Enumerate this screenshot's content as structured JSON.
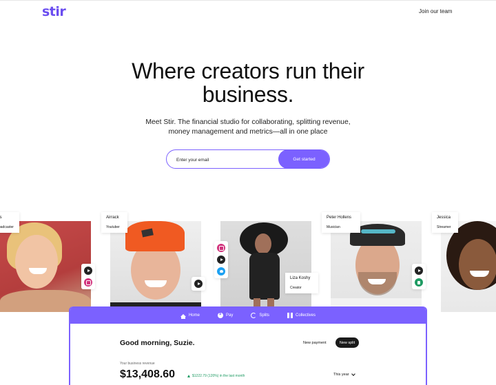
{
  "header": {
    "logo": "stir",
    "join_link": "Join our team"
  },
  "hero": {
    "title": "Where creators run their business.",
    "subtitle": "Meet Stir. The financial studio for collaborating, splitting revenue, money management and metrics—all in one place",
    "email_placeholder": "Enter your email",
    "cta_label": "Get started"
  },
  "creators": [
    {
      "name": "ans",
      "role": "Broadcaster",
      "socials": [
        "youtube-icon",
        "instagram-icon"
      ]
    },
    {
      "name": "Airrack",
      "role": "Youtuber",
      "socials": [
        "youtube-icon"
      ]
    },
    {
      "name": "Liza Koshy",
      "role": "Creator",
      "socials": [
        "instagram-icon",
        "youtube-icon",
        "twitter-icon"
      ]
    },
    {
      "name": "Peter Hollens",
      "role": "Musician",
      "socials": [
        "youtube-icon",
        "shopify-icon"
      ]
    },
    {
      "name": "Jessica",
      "role": "Streamer",
      "socials": []
    }
  ],
  "dashboard": {
    "nav": [
      {
        "label": "Home",
        "icon": "home-icon"
      },
      {
        "label": "Pay",
        "icon": "pay-icon"
      },
      {
        "label": "Splits",
        "icon": "splits-icon"
      },
      {
        "label": "Collectives",
        "icon": "collectives-icon"
      }
    ],
    "greeting": "Good morning, Suzie.",
    "new_payment": "New payment",
    "new_split": "New split",
    "revenue_label": "Your business revenue",
    "revenue_amount": "$13,408.60",
    "revenue_change": "$1222.79 (120%) in the last month",
    "period": "This year"
  },
  "colors": {
    "brand": "#7b61ff",
    "positive": "#1f9b63"
  }
}
